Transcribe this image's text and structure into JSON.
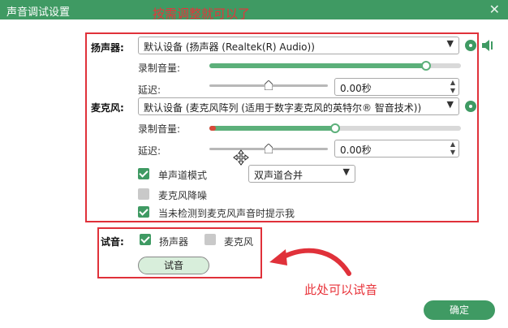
{
  "window": {
    "title": "声音调试设置",
    "close_glyph": "✕"
  },
  "annotations": {
    "top": "按需调整就可以了",
    "bottom": "此处可以试音"
  },
  "speaker": {
    "label": "扬声器:",
    "device": "默认设备 (扬声器 (Realtek(R) Audio))",
    "volume_label": "录制音量:",
    "volume_level": 0.86,
    "delay_label": "延迟:",
    "delay_value": "0.00秒"
  },
  "mic": {
    "label": "麦克风:",
    "device": "默认设备 (麦克风阵列 (适用于数字麦克风的英特尔® 智音技术))",
    "volume_label": "录制音量:",
    "volume_level": 0.5,
    "delay_label": "延迟:",
    "delay_value": "0.00秒"
  },
  "options": {
    "mono_label": "单声道模式",
    "mono_checked": true,
    "mono_mode": "双声道合并",
    "noise_label": "麦克风降噪",
    "noise_checked": false,
    "notify_label": "当未检测到麦克风声音时提示我",
    "notify_checked": true
  },
  "test": {
    "label": "试音:",
    "speaker_label": "扬声器",
    "speaker_checked": true,
    "mic_label": "麦克风",
    "mic_checked": false,
    "button": "试音"
  },
  "footer": {
    "ok": "确定"
  },
  "colors": {
    "accent": "#3f9a63",
    "annotation": "#e8333a"
  },
  "icons": {
    "dropdown": "▾",
    "spin_up": "▲",
    "spin_down": "▼"
  }
}
